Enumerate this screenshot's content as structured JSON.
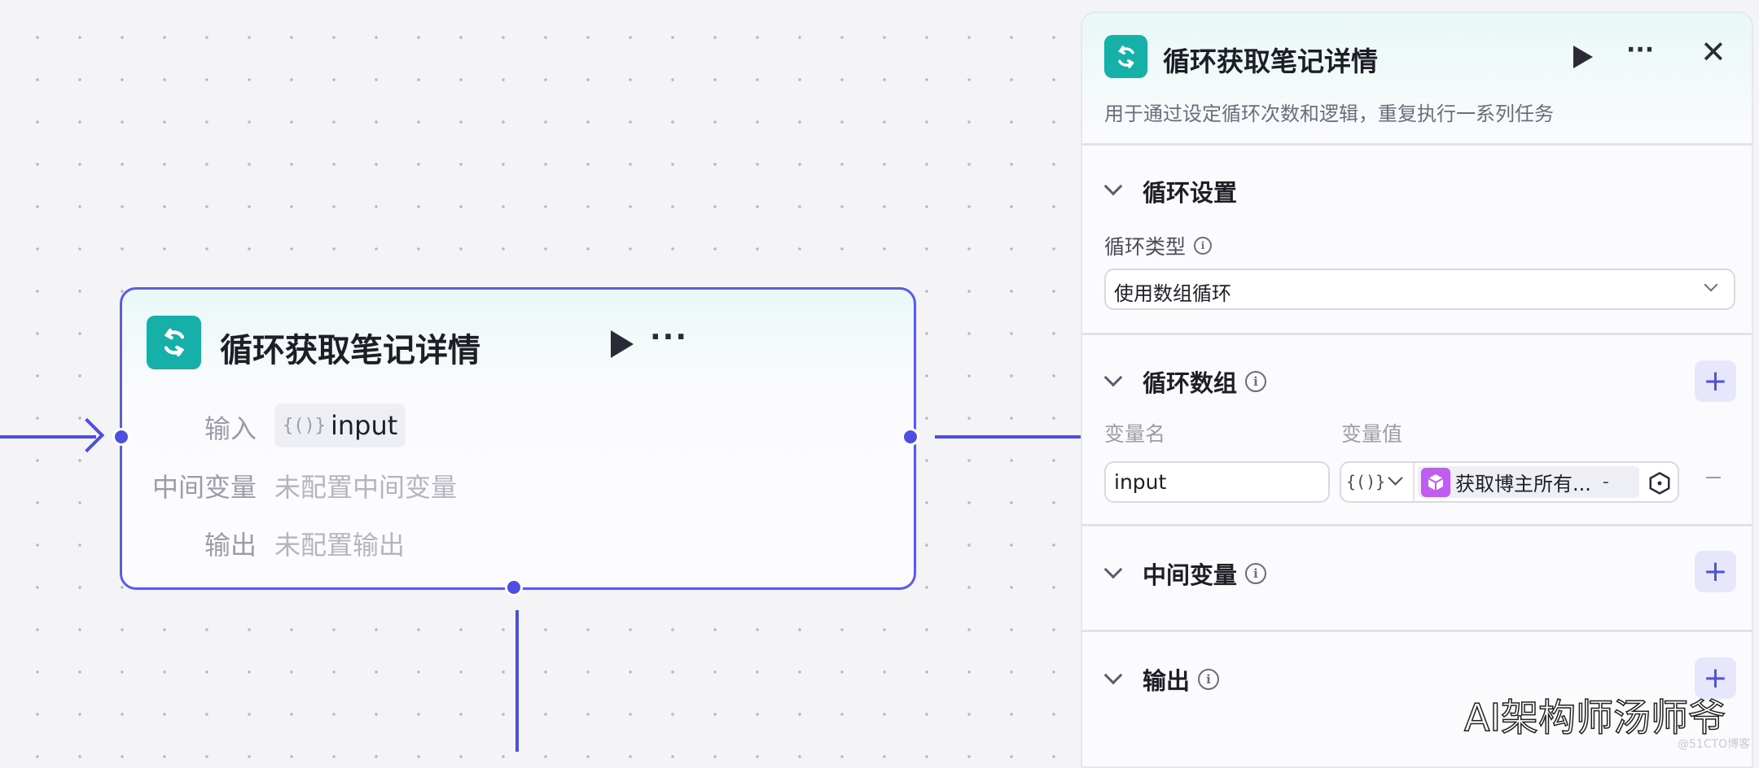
{
  "canvas": {
    "node": {
      "title": "循环获取笔记详情",
      "icon": "loop-refresh-icon",
      "rows": [
        {
          "label": "输入",
          "value": "input",
          "value_icon": "{()}"
        },
        {
          "label": "中间变量",
          "value": "未配置中间变量"
        },
        {
          "label": "输出",
          "value": "未配置输出"
        }
      ]
    }
  },
  "panel": {
    "title": "循环获取笔记详情",
    "description": "用于通过设定循环次数和逻辑，重复执行一系列任务",
    "sections": {
      "loop_settings": {
        "title": "循环设置",
        "type_label": "循环类型",
        "type_value": "使用数组循环"
      },
      "loop_array": {
        "title": "循环数组",
        "col_name": "变量名",
        "col_value": "变量值",
        "var_name": "input",
        "type_icon": "{()}",
        "ref_value": "获取博主所有...",
        "ref_suffix": "-"
      },
      "intermediate": {
        "title": "中间变量"
      },
      "output": {
        "title": "输出"
      }
    }
  },
  "watermark": {
    "main": "AI架构师汤师爷",
    "sub": "@51CTO博客"
  },
  "colors": {
    "accent": "#4e4fe0",
    "node_icon": "#16b0a8",
    "ref_icon": "#c05cf0"
  }
}
